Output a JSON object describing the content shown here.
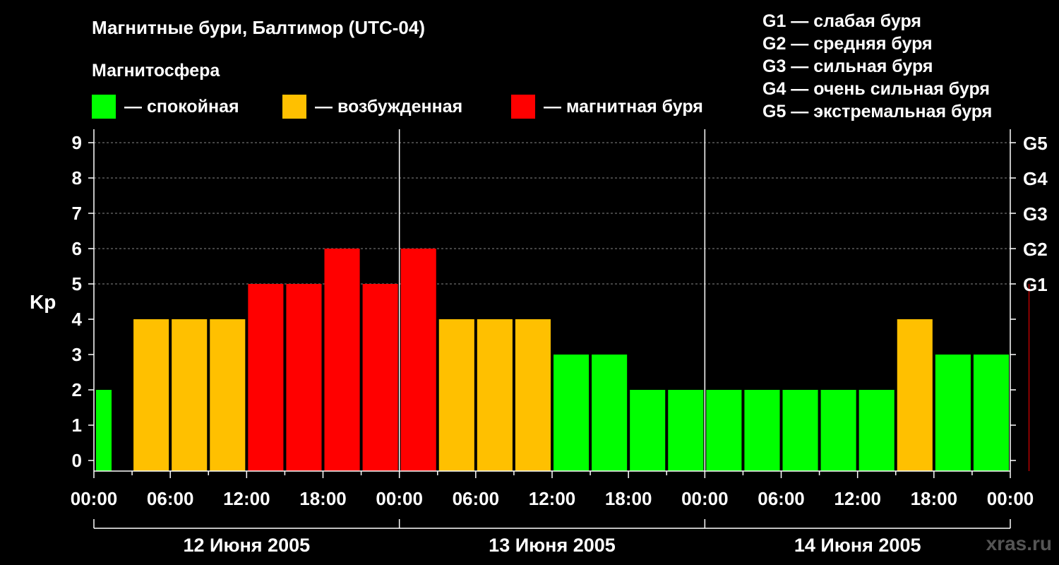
{
  "title": "Магнитные бури, Балтимор (UTC-04)",
  "subtitle": "Магнитосфера",
  "legend": [
    {
      "label": "— спокойная",
      "color": "#00ff00"
    },
    {
      "label": "— возбужденная",
      "color": "#ffc000"
    },
    {
      "label": "— магнитная буря",
      "color": "#ff0000"
    }
  ],
  "g_legend": [
    "G1 — слабая буря",
    "G2 — средняя буря",
    "G3 — сильная буря",
    "G4 — очень сильная буря",
    "G5 — экстремальная буря"
  ],
  "watermark": "xras.ru",
  "colors": {
    "quiet": "#00ff00",
    "active": "#ffc000",
    "storm": "#ff0000",
    "grid": "#888888",
    "axis": "#ffffff"
  },
  "chart_data": {
    "type": "bar",
    "ylabel": "Kp",
    "ylim": [
      0,
      9
    ],
    "y_ticks": [
      "0",
      "1",
      "2",
      "3",
      "4",
      "5",
      "6",
      "7",
      "8",
      "9"
    ],
    "right_ticks": [
      {
        "value": 5,
        "label": "G1"
      },
      {
        "value": 6,
        "label": "G2"
      },
      {
        "value": 7,
        "label": "G3"
      },
      {
        "value": 8,
        "label": "G4"
      },
      {
        "value": 9,
        "label": "G5"
      }
    ],
    "x_tick_labels": [
      "00:00",
      "06:00",
      "12:00",
      "18:00",
      "00:00",
      "06:00",
      "12:00",
      "18:00",
      "00:00",
      "06:00",
      "12:00",
      "18:00",
      "00:00"
    ],
    "days": [
      "12 Июня 2005",
      "13 Июня 2005",
      "14 Июня 2005"
    ],
    "hours_per_bar": 3,
    "values": [
      2,
      4,
      4,
      4,
      5,
      5,
      6,
      5,
      6,
      4,
      4,
      4,
      3,
      3,
      2,
      2,
      2,
      2,
      2,
      2,
      2,
      4,
      3,
      3,
      5
    ],
    "grid": true
  }
}
